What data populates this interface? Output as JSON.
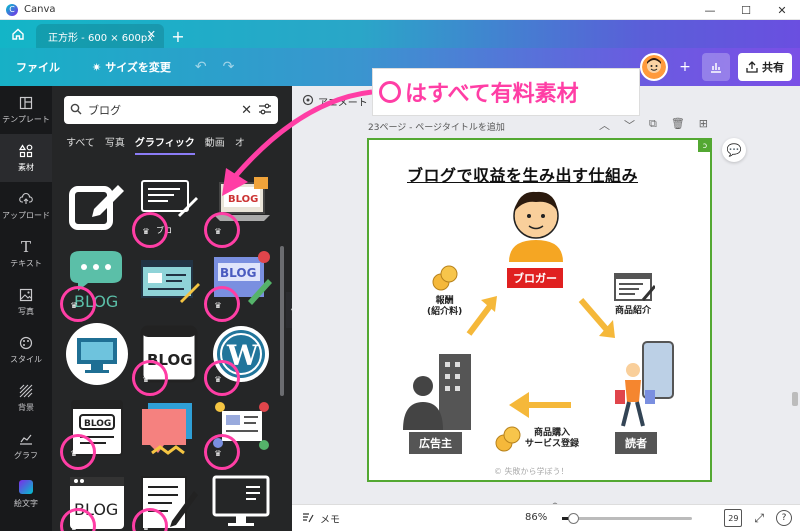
{
  "window": {
    "app_name": "Canva"
  },
  "tabs": [
    {
      "label": "正方形 - 600 × 600px"
    }
  ],
  "toolbar": {
    "file": "ファイル",
    "resize": "サイズを変更",
    "share": "共有"
  },
  "rail": [
    {
      "label": "テンプレート",
      "icon": "template-icon"
    },
    {
      "label": "素材",
      "icon": "elements-icon",
      "active": true
    },
    {
      "label": "アップロード",
      "icon": "upload-icon"
    },
    {
      "label": "テキスト",
      "icon": "text-icon"
    },
    {
      "label": "写真",
      "icon": "photo-icon"
    },
    {
      "label": "スタイル",
      "icon": "style-icon"
    },
    {
      "label": "背景",
      "icon": "background-icon"
    },
    {
      "label": "グラフ",
      "icon": "chart-icon"
    },
    {
      "label": "絵文字",
      "icon": "emoji-icon"
    }
  ],
  "panel": {
    "search": {
      "value": "ブログ"
    },
    "categories": [
      "すべて",
      "写真",
      "グラフィック",
      "動画",
      "オ"
    ],
    "active_category": "グラフィック",
    "tiles": [
      {
        "name": "edit-square-graphic",
        "premium": false
      },
      {
        "name": "blog-post-line-graphic",
        "premium": true,
        "label": "ブロ"
      },
      {
        "name": "laptop-blog-graphic",
        "premium": true
      },
      {
        "name": "blog-speech-bubble-graphic",
        "premium": true,
        "label": "BLOG"
      },
      {
        "name": "blog-browser-pencil-graphic",
        "premium": false
      },
      {
        "name": "blog-settings-screen-graphic",
        "premium": true,
        "label": "BLOG"
      },
      {
        "name": "monitor-circle-graphic",
        "premium": false
      },
      {
        "name": "blog-window-graphic",
        "premium": true,
        "label": "BLOG"
      },
      {
        "name": "wordpress-logo-graphic",
        "premium": true
      },
      {
        "name": "blog-document-graphic",
        "premium": true,
        "label": "BLOG"
      },
      {
        "name": "speech-card-graphic",
        "premium": false
      },
      {
        "name": "blogger-desk-graphic",
        "premium": true
      },
      {
        "name": "blog-sketch-graphic",
        "premium": true,
        "label": "BLOG"
      },
      {
        "name": "note-pencil-graphic",
        "premium": true
      },
      {
        "name": "monitor-outline-graphic",
        "premium": false
      }
    ]
  },
  "callout": {
    "text": "はすべて有料素材"
  },
  "editor": {
    "animate": "アニメート",
    "page_label": "23ページ - ページタイトルを追加"
  },
  "infographic": {
    "title": "ブログで収益を生み出す仕組み",
    "blogger": "ブロガー",
    "advertiser": "広告主",
    "reader": "読者",
    "reward": "報酬\n(紹介料)",
    "product_intro": "商品紹介",
    "purchase": "商品購入\nサービス登録",
    "watermark": "© 失敗から学ぼう！"
  },
  "bottombar": {
    "memo": "メモ",
    "zoom": "86%",
    "pages": "29"
  },
  "colors": {
    "accent_pink": "#ff3ea5",
    "canva_teal": "#13b5c7",
    "canva_purple": "#6a4fe0",
    "panel_bg": "#252627",
    "rail_bg": "#18191b",
    "canvas_border": "#53a832",
    "label_red": "#e02020"
  }
}
